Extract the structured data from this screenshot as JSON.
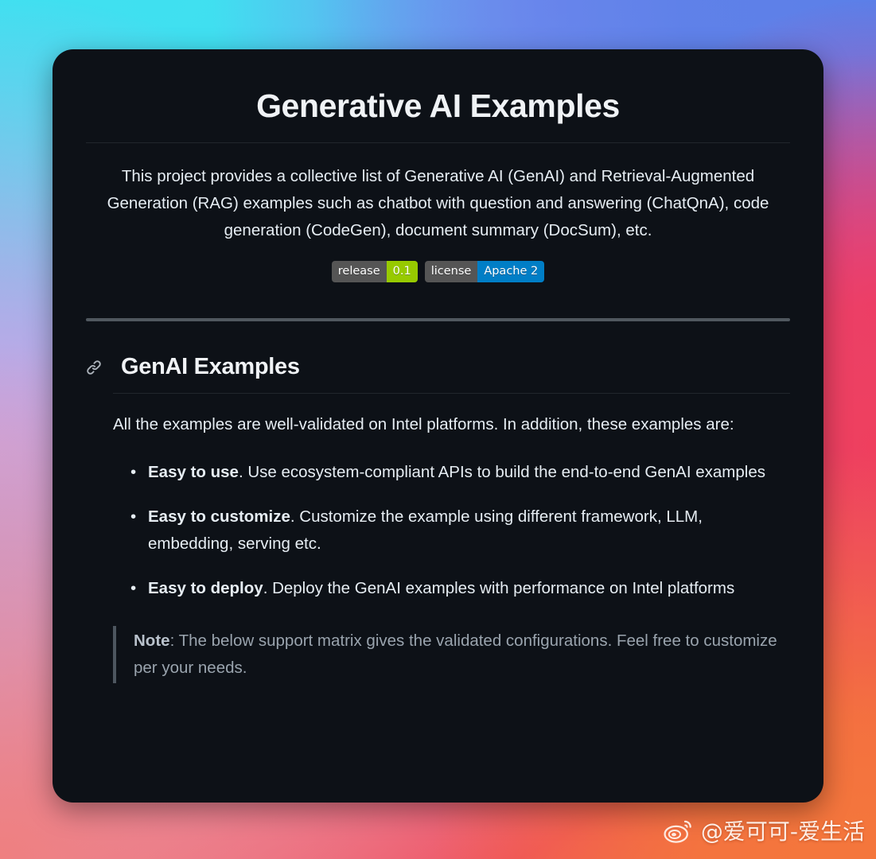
{
  "background": {
    "colors": [
      "#45dff0",
      "#8f9ef0",
      "#c6a6e6",
      "#e87fa0",
      "#ef4f5e",
      "#f4763c"
    ]
  },
  "card": {
    "background_color": "#0d1117",
    "title": "Generative AI Examples",
    "intro": "This project provides a collective list of Generative AI (GenAI) and Retrieval-Augmented Generation (RAG) examples such as chatbot with question and answering (ChatQnA), code generation (CodeGen), document summary (DocSum), etc.",
    "badges": [
      {
        "name": "release-badge",
        "label": "release",
        "value": "0.1",
        "label_color": "#555555",
        "value_color": "#97ca00"
      },
      {
        "name": "license-badge",
        "label": "license",
        "value": "Apache 2",
        "label_color": "#555555",
        "value_color": "#007ec6"
      }
    ],
    "section": {
      "anchor_icon": "link-icon",
      "heading": "GenAI Examples",
      "lead": "All the examples are well-validated on Intel platforms. In addition, these examples are:",
      "features": [
        {
          "term": "Easy to use",
          "description": ". Use ecosystem-compliant APIs to build the end-to-end GenAI examples"
        },
        {
          "term": "Easy to customize",
          "description": ". Customize the example using different framework, LLM, embedding, serving etc."
        },
        {
          "term": "Easy to deploy",
          "description": ". Deploy the GenAI examples with performance on Intel platforms"
        }
      ],
      "note": {
        "term": "Note",
        "description": ": The below support matrix gives the validated configurations. Feel free to customize per your needs."
      }
    }
  },
  "watermark": {
    "icon": "weibo-icon",
    "text": "@爱可可-爱生活"
  }
}
